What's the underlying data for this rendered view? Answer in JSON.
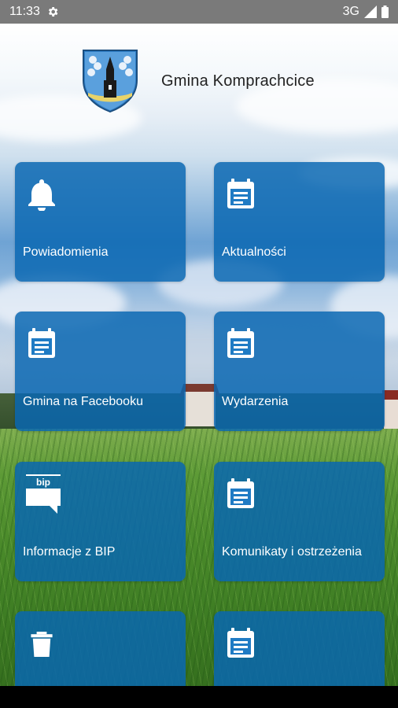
{
  "status_bar": {
    "time": "11:33",
    "network": "3G",
    "icons": [
      "gear-icon",
      "signal-icon",
      "battery-icon"
    ]
  },
  "header": {
    "title": "Gmina Komprachcice",
    "logo_icon": "coat-of-arms-icon"
  },
  "tiles": [
    {
      "label": "Powiadomienia",
      "icon": "bell-icon"
    },
    {
      "label": "Aktualności",
      "icon": "calendar-icon"
    },
    {
      "label": "Gmina na Facebooku",
      "icon": "calendar-icon"
    },
    {
      "label": "Wydarzenia",
      "icon": "calendar-icon"
    },
    {
      "label": "Informacje z BIP",
      "icon": "bip-icon"
    },
    {
      "label": "Komunikaty i ostrzeżenia",
      "icon": "calendar-icon"
    },
    {
      "label": "",
      "icon": "trash-icon"
    },
    {
      "label": "",
      "icon": "calendar-icon"
    }
  ],
  "colors": {
    "tile": "#0866B2",
    "status_bar": "#7A7A7A"
  },
  "bip_text": "bip"
}
